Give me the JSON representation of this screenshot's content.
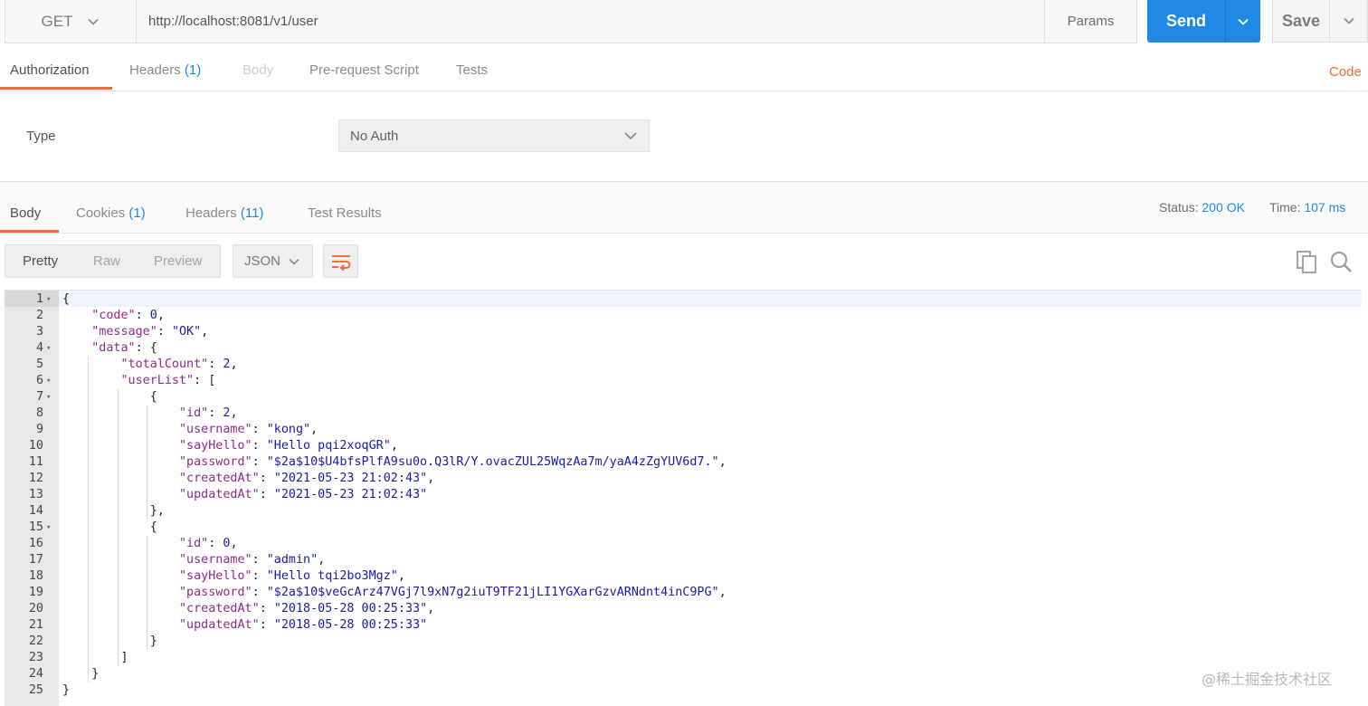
{
  "request": {
    "method": "GET",
    "url": "http://localhost:8081/v1/user",
    "params_label": "Params",
    "send_label": "Send",
    "save_label": "Save"
  },
  "request_tabs": {
    "authorization": "Authorization",
    "headers": "Headers",
    "headers_count": "(1)",
    "body": "Body",
    "prerequest": "Pre-request Script",
    "tests": "Tests",
    "code": "Code"
  },
  "auth": {
    "type_label": "Type",
    "type_value": "No Auth"
  },
  "response_tabs": {
    "body": "Body",
    "cookies": "Cookies",
    "cookies_count": "(1)",
    "headers": "Headers",
    "headers_count": "(11)",
    "test_results": "Test Results"
  },
  "response_status": {
    "status_label": "Status:",
    "status_value": "200 OK",
    "time_label": "Time:",
    "time_value": "107 ms"
  },
  "view_modes": {
    "pretty": "Pretty",
    "raw": "Raw",
    "preview": "Preview",
    "format": "JSON"
  },
  "code_lines": [
    {
      "n": "1",
      "t": "{"
    },
    {
      "n": "2",
      "t": "    \"code\": 0,"
    },
    {
      "n": "3",
      "t": "    \"message\": \"OK\","
    },
    {
      "n": "4",
      "t": "    \"data\": {"
    },
    {
      "n": "5",
      "t": "        \"totalCount\": 2,"
    },
    {
      "n": "6",
      "t": "        \"userList\": ["
    },
    {
      "n": "7",
      "t": "            {"
    },
    {
      "n": "8",
      "t": "                \"id\": 2,"
    },
    {
      "n": "9",
      "t": "                \"username\": \"kong\","
    },
    {
      "n": "10",
      "t": "                \"sayHello\": \"Hello pqi2xoqGR\","
    },
    {
      "n": "11",
      "t": "                \"password\": \"$2a$10$U4bfsPlfA9su0o.Q3lR/Y.ovacZUL25WqzAa7m/yaA4zZgYUV6d7.\","
    },
    {
      "n": "12",
      "t": "                \"createdAt\": \"2021-05-23 21:02:43\","
    },
    {
      "n": "13",
      "t": "                \"updatedAt\": \"2021-05-23 21:02:43\""
    },
    {
      "n": "14",
      "t": "            },"
    },
    {
      "n": "15",
      "t": "            {"
    },
    {
      "n": "16",
      "t": "                \"id\": 0,"
    },
    {
      "n": "17",
      "t": "                \"username\": \"admin\","
    },
    {
      "n": "18",
      "t": "                \"sayHello\": \"Hello tqi2bo3Mgz\","
    },
    {
      "n": "19",
      "t": "                \"password\": \"$2a$10$veGcArz47VGj7l9xN7g2iuT9TF21jLI1YGXarGzvARNdnt4inC9PG\","
    },
    {
      "n": "20",
      "t": "                \"createdAt\": \"2018-05-28 00:25:33\","
    },
    {
      "n": "21",
      "t": "                \"updatedAt\": \"2018-05-28 00:25:33\""
    },
    {
      "n": "22",
      "t": "            }"
    },
    {
      "n": "23",
      "t": "        ]"
    },
    {
      "n": "24",
      "t": "    }"
    },
    {
      "n": "25",
      "t": "}"
    }
  ],
  "folds": [
    "1",
    "4",
    "6",
    "7",
    "15"
  ],
  "watermark": "@稀土掘金技术社区",
  "colors": {
    "accent_orange": "#f26b3a",
    "primary_blue": "#1f88e5",
    "json_key": "#92278f",
    "json_value": "#1a1aa6"
  }
}
